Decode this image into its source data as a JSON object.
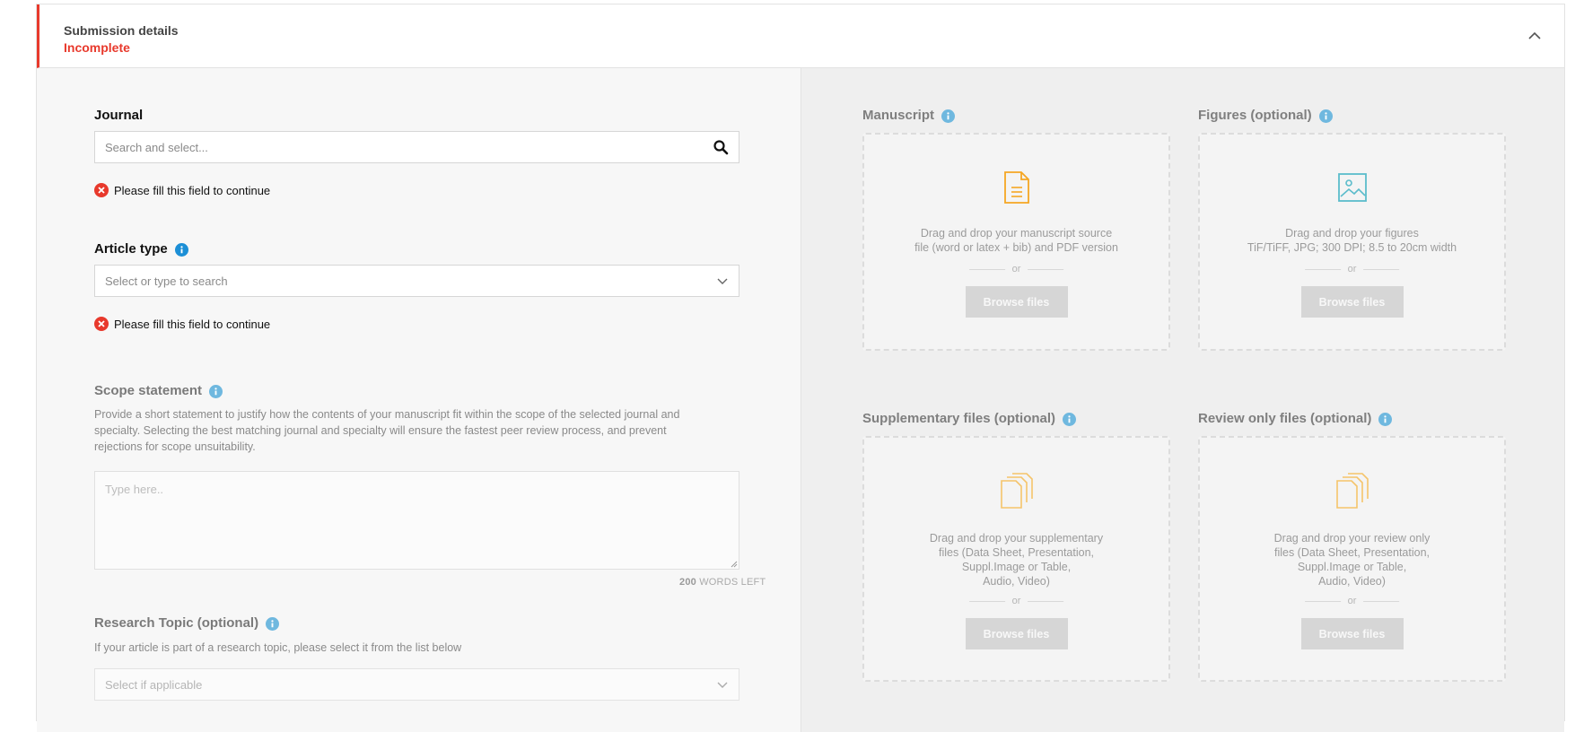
{
  "header": {
    "title": "Submission details",
    "status": "Incomplete"
  },
  "form": {
    "journal": {
      "label": "Journal",
      "placeholder": "Search and select...",
      "error": "Please fill this field to continue"
    },
    "article_type": {
      "label": "Article type",
      "placeholder": "Select or type to search",
      "error": "Please fill this field to continue"
    },
    "scope_statement": {
      "label": "Scope statement",
      "help_lines": [
        "Provide a short statement to justify how the contents of your manuscript fit within the scope of the selected journal and",
        "specialty. Selecting the best matching journal and specialty will ensure the fastest peer review process, and prevent",
        "rejections for scope unsuitability."
      ],
      "placeholder": "Type here..",
      "words_count": "200",
      "words_suffix": "WORDS LEFT"
    },
    "research_topic": {
      "label": "Research Topic (optional)",
      "help": "If your article is part of a research topic, please select it from the list below",
      "placeholder": "Select if applicable"
    }
  },
  "uploads": [
    {
      "title": "Manuscript",
      "icon": "document-icon",
      "lines": [
        "Drag and drop your manuscript source",
        "file (word or latex + bib) and PDF version"
      ],
      "or": "or",
      "button": "Browse files"
    },
    {
      "title": "Figures (optional)",
      "icon": "image-icon",
      "lines": [
        "Drag and drop your figures",
        "TiF/TiFF, JPG; 300 DPI; 8.5 to 20cm width"
      ],
      "or": "or",
      "button": "Browse files"
    },
    {
      "title": "Supplementary files (optional)",
      "icon": "files-icon",
      "lines": [
        "Drag and drop your supplementary",
        "files (Data Sheet, Presentation,",
        "Suppl.Image or Table,",
        "Audio, Video)"
      ],
      "or": "or",
      "button": "Browse files"
    },
    {
      "title": "Review only files (optional)",
      "icon": "files-icon",
      "lines": [
        "Drag and drop your review only",
        "files (Data Sheet, Presentation,",
        "Suppl.Image or Table,",
        "Audio, Video)"
      ],
      "or": "or",
      "button": "Browse files"
    }
  ],
  "colors": {
    "error_red": "#e8392c",
    "info_blue": "#1c8fd6",
    "icon_orange": "#f5a623",
    "icon_teal": "#5bbccb"
  }
}
